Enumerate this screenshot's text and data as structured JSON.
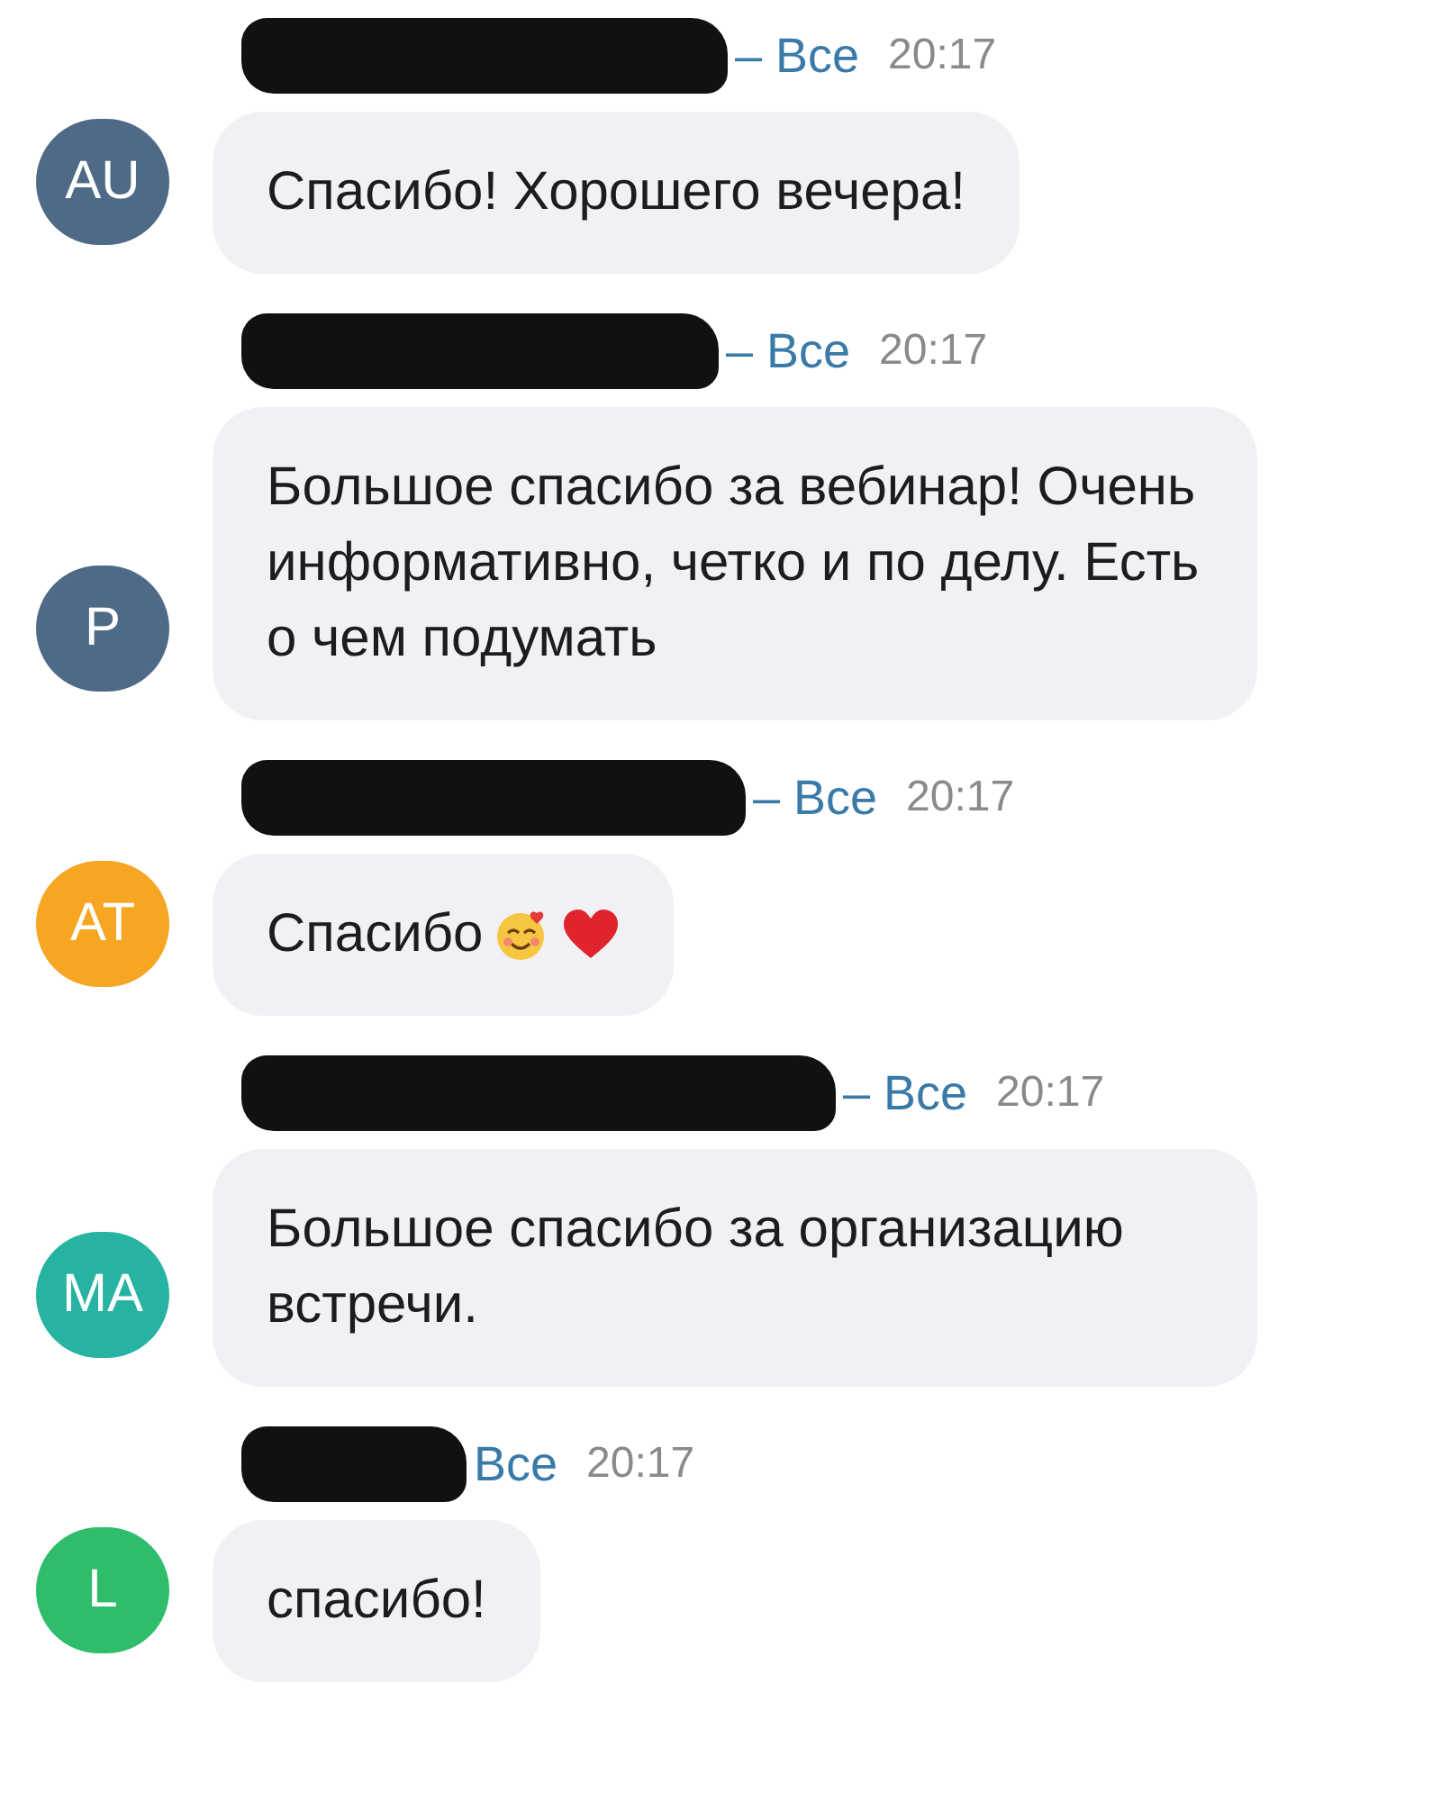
{
  "messages": [
    {
      "avatar": {
        "initials": "AU",
        "color": "#4f6a86"
      },
      "sender_redacted": true,
      "audience": "– Все",
      "time": "20:17",
      "text": "Спасибо! Хорошего вечера!",
      "emoji": false
    },
    {
      "avatar": {
        "initials": "P",
        "color": "#4f6a86"
      },
      "sender_redacted": true,
      "audience": "– Все",
      "time": "20:17",
      "text": "Большое спасибо за вебинар! Очень информативно, четко и по делу. Есть о чем подумать",
      "emoji": false
    },
    {
      "avatar": {
        "initials": "AT",
        "color": "#f6a623"
      },
      "sender_redacted": true,
      "audience": "– Все",
      "time": "20:17",
      "text": "Спасибо",
      "emoji": true
    },
    {
      "avatar": {
        "initials": "MA",
        "color": "#27b3a2"
      },
      "sender_redacted": true,
      "audience": "– Все",
      "time": "20:17",
      "text": "Большое спасибо за организацию встречи.",
      "emoji": false
    },
    {
      "avatar": {
        "initials": "L",
        "color": "#2fbd6b"
      },
      "sender_redacted": true,
      "audience": "Все",
      "time": "20:17",
      "text": "спасибо!",
      "emoji": false
    }
  ]
}
